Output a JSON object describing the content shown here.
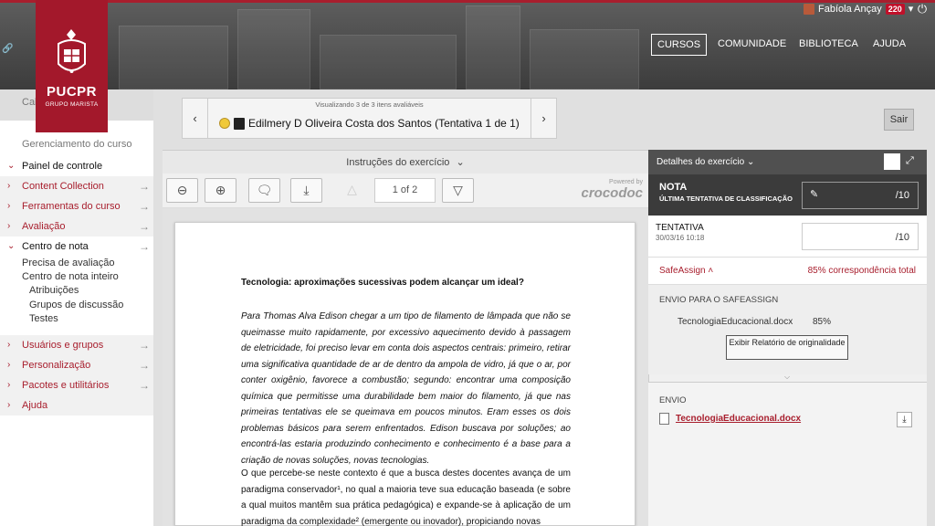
{
  "header": {
    "logo_name": "PUCPR",
    "logo_sub": "GRUPO MARISTA",
    "nav": [
      "CURSOS",
      "COMUNIDADE",
      "BIBLIOTECA",
      "AJUDA"
    ],
    "user_name": "Fabíola Ançay",
    "notification_count": "220"
  },
  "sidebar": {
    "top_label": "Cal",
    "section_title": "Gerenciamento do curso",
    "items": [
      {
        "label": "Painel de controle",
        "arrow": false
      },
      {
        "label": "Content Collection",
        "arrow": true
      },
      {
        "label": "Ferramentas do curso",
        "arrow": true
      },
      {
        "label": "Avaliação",
        "arrow": true
      },
      {
        "label": "Centro de nota",
        "arrow": true
      }
    ],
    "sub_items": [
      "Precisa de avaliação",
      "Centro de nota inteiro"
    ],
    "sub_sub_items": [
      "Atribuições",
      "Grupos de discussão",
      "Testes"
    ],
    "bottom_items": [
      {
        "label": "Usuários e grupos",
        "arrow": true
      },
      {
        "label": "Personalização",
        "arrow": true
      },
      {
        "label": "Pacotes e utilitários",
        "arrow": true
      },
      {
        "label": "Ajuda",
        "arrow": false
      }
    ]
  },
  "navigator": {
    "viewing": "Visualizando 3 de 3 itens avaliáveis",
    "student": "Edilmery D Oliveira Costa dos Santos (Tentativa 1 de 1)",
    "exit": "Sair"
  },
  "instructions": "Instruções do exercício",
  "toolbar": {
    "page": "1 of 2",
    "powered_by": "Powered by",
    "brand": "crocodoc"
  },
  "document": {
    "title": "Tecnologia: aproximações sucessivas podem alcançar um ideal?",
    "paragraph1": "Para Thomas Alva Edison chegar a um tipo de filamento de lâmpada que não se queimasse muito rapidamente, por excessivo aquecimento devido à passagem de eletricidade, foi preciso levar em conta dois aspectos centrais: primeiro, retirar uma significativa quantidade de ar de dentro da ampola de vidro, já que o ar, por conter oxigênio, favorece a combustão; segundo: encontrar uma composição química que permitisse uma durabilidade bem maior do filamento, já que nas primeiras tentativas ele se queimava em poucos minutos. Eram esses os dois problemas básicos para serem enfrentados. Edison buscava por soluções; ao encontrá-las estaria produzindo conhecimento e conhecimento é a base para a criação de novas soluções, novas tecnologias.",
    "paragraph2": "O que percebe-se neste contexto é que a busca destes docentes avança de um paradigma conservador¹, no qual a maioria teve sua educação baseada (e sobre a qual muitos mantêm sua prática pedagógica) e expande-se à aplicação de um paradigma da complexidade² (emergente ou inovador), propiciando novas"
  },
  "right_panel": {
    "header": "Detalhes do exercício",
    "nota_title": "NOTA",
    "nota_sub": "ÚLTIMA TENTATIVA DE CLASSIFICAÇÃO",
    "nota_value": "/10",
    "tentativa_title": "TENTATIVA",
    "tentativa_date": "30/03/16 10:18",
    "tentativa_value": "/10",
    "safeassign_label": "SafeAssign",
    "safeassign_match": "85% correspondência total",
    "envio_safe_title": "ENVIO PARA O SAFEASSIGN",
    "envio_safe_file": "TecnologiaEducacional.docx",
    "envio_safe_pct": "85%",
    "report_button": "Exibir Relatório de originalidade",
    "envio_title": "ENVIO",
    "envio_file": "TecnologiaEducacional.docx"
  },
  "colors": {
    "brand": "#a3182b",
    "accent": "#a81e2d",
    "header_dark": "#3b3b3b"
  }
}
